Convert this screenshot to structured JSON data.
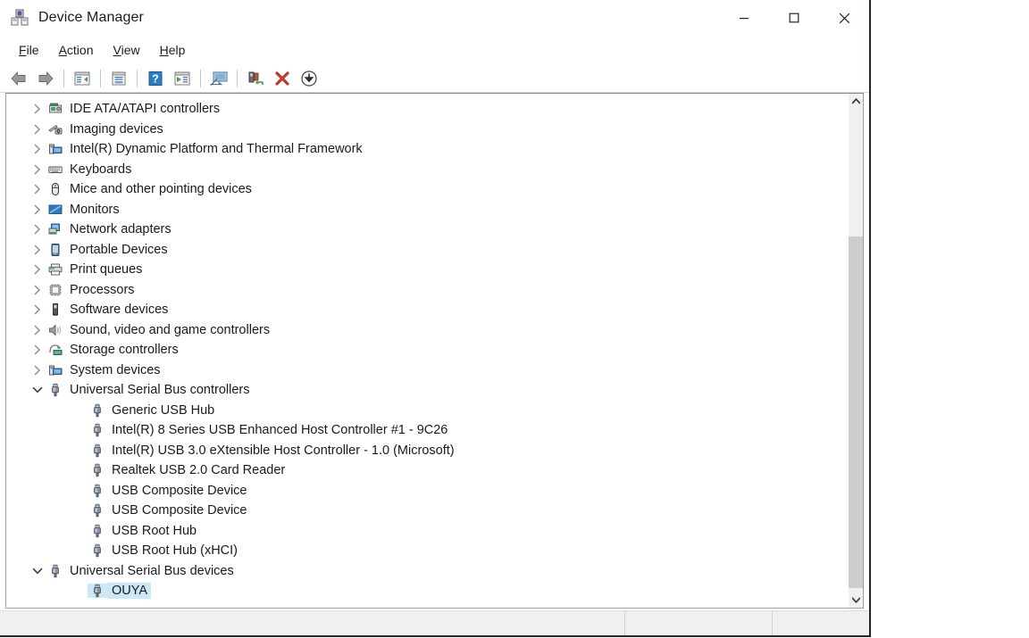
{
  "window": {
    "title": "Device Manager",
    "title_icon": "device-manager-icon",
    "controls": {
      "minimize": "minimize-icon",
      "maximize": "maximize-icon",
      "close": "close-icon"
    }
  },
  "menubar": {
    "items": [
      {
        "label": "File",
        "accel": "F",
        "rest": "ile"
      },
      {
        "label": "Action",
        "accel": "A",
        "rest": "ction"
      },
      {
        "label": "View",
        "accel": "V",
        "rest": "iew"
      },
      {
        "label": "Help",
        "accel": "H",
        "rest": "elp"
      }
    ]
  },
  "toolbar": {
    "buttons": [
      {
        "name": "back-button",
        "icon": "back-arrow-icon",
        "tooltip": "Back"
      },
      {
        "name": "forward-button",
        "icon": "forward-arrow-icon",
        "tooltip": "Forward"
      },
      {
        "name": "show-hide-console-tree-button",
        "icon": "console-tree-icon",
        "tooltip": "Show/Hide Console Tree"
      },
      {
        "name": "properties-button",
        "icon": "properties-icon",
        "tooltip": "Properties"
      },
      {
        "name": "help-button",
        "icon": "help-icon",
        "tooltip": "Help"
      },
      {
        "name": "update-driver-button",
        "icon": "update-driver-icon",
        "tooltip": "Update Driver Software"
      },
      {
        "name": "scan-hardware-changes-button",
        "icon": "scan-monitor-icon",
        "tooltip": "Scan for hardware changes"
      },
      {
        "name": "enable-device-button",
        "icon": "enable-device-icon",
        "tooltip": "Enable device"
      },
      {
        "name": "uninstall-device-button",
        "icon": "red-x-icon",
        "tooltip": "Uninstall device"
      },
      {
        "name": "disable-device-button",
        "icon": "down-arrow-circle-icon",
        "tooltip": "Disable device"
      }
    ]
  },
  "tree": {
    "rows": [
      {
        "label": "IDE ATA/ATAPI controllers",
        "depth": 0,
        "expander": "collapsed",
        "icon": "ide-controller-icon",
        "selected": false
      },
      {
        "label": "Imaging devices",
        "depth": 0,
        "expander": "collapsed",
        "icon": "imaging-device-icon",
        "selected": false
      },
      {
        "label": "Intel(R) Dynamic Platform and Thermal Framework",
        "depth": 0,
        "expander": "collapsed",
        "icon": "system-device-icon",
        "selected": false
      },
      {
        "label": "Keyboards",
        "depth": 0,
        "expander": "collapsed",
        "icon": "keyboard-icon",
        "selected": false
      },
      {
        "label": "Mice and other pointing devices",
        "depth": 0,
        "expander": "collapsed",
        "icon": "mouse-icon",
        "selected": false
      },
      {
        "label": "Monitors",
        "depth": 0,
        "expander": "collapsed",
        "icon": "monitor-icon",
        "selected": false
      },
      {
        "label": "Network adapters",
        "depth": 0,
        "expander": "collapsed",
        "icon": "network-adapter-icon",
        "selected": false
      },
      {
        "label": "Portable Devices",
        "depth": 0,
        "expander": "collapsed",
        "icon": "portable-device-icon",
        "selected": false
      },
      {
        "label": "Print queues",
        "depth": 0,
        "expander": "collapsed",
        "icon": "printer-icon",
        "selected": false
      },
      {
        "label": "Processors",
        "depth": 0,
        "expander": "collapsed",
        "icon": "processor-icon",
        "selected": false
      },
      {
        "label": "Software devices",
        "depth": 0,
        "expander": "collapsed",
        "icon": "software-device-icon",
        "selected": false
      },
      {
        "label": "Sound, video and game controllers",
        "depth": 0,
        "expander": "collapsed",
        "icon": "speaker-icon",
        "selected": false
      },
      {
        "label": "Storage controllers",
        "depth": 0,
        "expander": "collapsed",
        "icon": "storage-controller-icon",
        "selected": false
      },
      {
        "label": "System devices",
        "depth": 0,
        "expander": "collapsed",
        "icon": "system-device-icon",
        "selected": false
      },
      {
        "label": "Universal Serial Bus controllers",
        "depth": 0,
        "expander": "expanded",
        "icon": "usb-icon",
        "selected": false
      },
      {
        "label": "Generic USB Hub",
        "depth": 1,
        "expander": "none",
        "icon": "usb-icon",
        "selected": false
      },
      {
        "label": "Intel(R) 8 Series USB Enhanced Host Controller #1 - 9C26",
        "depth": 1,
        "expander": "none",
        "icon": "usb-icon",
        "selected": false
      },
      {
        "label": "Intel(R) USB 3.0 eXtensible Host Controller - 1.0 (Microsoft)",
        "depth": 1,
        "expander": "none",
        "icon": "usb-icon",
        "selected": false
      },
      {
        "label": "Realtek USB 2.0 Card Reader",
        "depth": 1,
        "expander": "none",
        "icon": "usb-icon",
        "selected": false
      },
      {
        "label": "USB Composite Device",
        "depth": 1,
        "expander": "none",
        "icon": "usb-icon",
        "selected": false
      },
      {
        "label": "USB Composite Device",
        "depth": 1,
        "expander": "none",
        "icon": "usb-icon",
        "selected": false
      },
      {
        "label": "USB Root Hub",
        "depth": 1,
        "expander": "none",
        "icon": "usb-icon",
        "selected": false
      },
      {
        "label": "USB Root Hub (xHCI)",
        "depth": 1,
        "expander": "none",
        "icon": "usb-icon",
        "selected": false
      },
      {
        "label": "Universal Serial Bus devices",
        "depth": 0,
        "expander": "expanded",
        "icon": "usb-icon",
        "selected": false
      },
      {
        "label": "OUYA",
        "depth": 1,
        "expander": "none",
        "icon": "usb-icon",
        "selected": true
      }
    ]
  },
  "scrollbar": {
    "up_arrow": "scroll-up-icon",
    "down_arrow": "scroll-down-icon"
  },
  "statusbar": {
    "panes": [
      "",
      "",
      ""
    ]
  },
  "colors": {
    "selection": "#cce8f7",
    "window_border": "#2b2029",
    "status_bg": "#f0f0ee",
    "scroll_thumb": "#cdcdcd"
  }
}
